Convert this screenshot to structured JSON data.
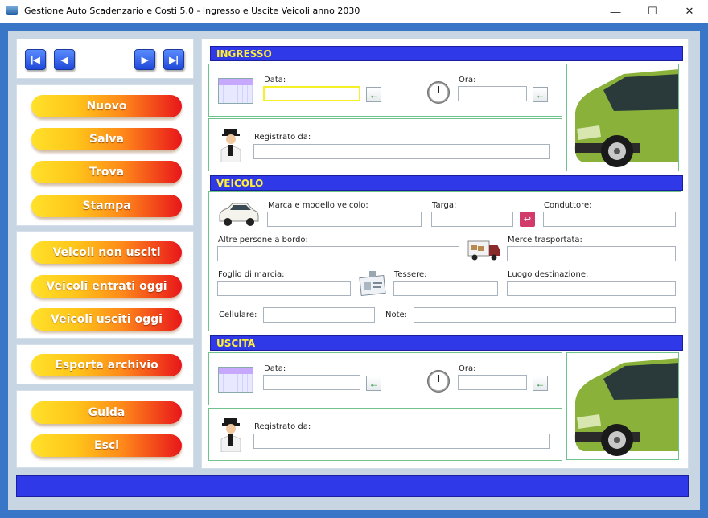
{
  "window": {
    "title": "Gestione Auto Scadenzario e Costi 5.0 - Ingresso e Uscite Veicoli anno 2030",
    "minimize": "—",
    "maximize": "☐",
    "close": "✕"
  },
  "nav": {
    "first": "|◀",
    "prev": "◀",
    "next": "▶",
    "last": "▶|"
  },
  "buttons": {
    "nuovo": "Nuovo",
    "salva": "Salva",
    "trova": "Trova",
    "stampa": "Stampa",
    "non_usciti": "Veicoli non usciti",
    "entrati_oggi": "Veicoli entrati oggi",
    "usciti_oggi": "Veicoli usciti oggi",
    "esporta": "Esporta archivio",
    "guida": "Guida",
    "esci": "Esci"
  },
  "ingresso": {
    "header": "INGRESSO",
    "data_label": "Data:",
    "ora_label": "Ora:",
    "registrato_label": "Registrato da:",
    "data_value": "",
    "ora_value": "",
    "registrato_value": ""
  },
  "veicolo": {
    "header": "VEICOLO",
    "marca_label": "Marca e modello veicolo:",
    "targa_label": "Targa:",
    "conduttore_label": "Conduttore:",
    "altre_label": "Altre persone a bordo:",
    "merce_label": "Merce trasportata:",
    "foglio_label": "Foglio di marcia:",
    "tessere_label": "Tessere:",
    "luogo_label": "Luogo destinazione:",
    "cellulare_label": "Cellulare:",
    "note_label": "Note:"
  },
  "uscita": {
    "header": "USCITA",
    "data_label": "Data:",
    "ora_label": "Ora:",
    "registrato_label": "Registrato da:"
  },
  "icons": {
    "arrow_back": "←",
    "pink_back": "↩"
  }
}
